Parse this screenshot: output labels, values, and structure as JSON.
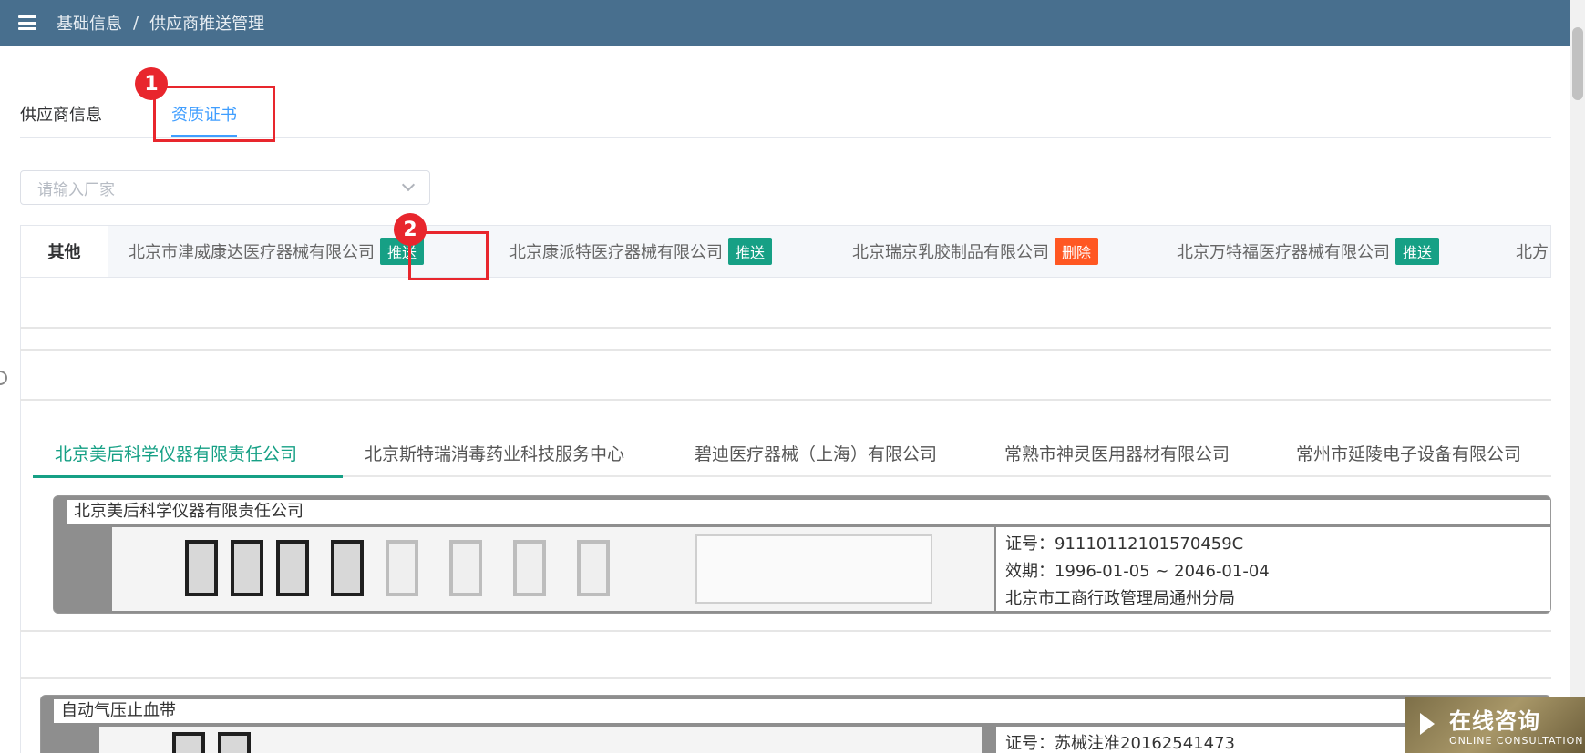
{
  "header": {
    "breadcrumb": [
      "基础信息",
      "供应商推送管理"
    ],
    "separator": "/"
  },
  "top_tabs": [
    {
      "label": "供应商信息",
      "active": false
    },
    {
      "label": "资质证书",
      "active": true
    }
  ],
  "annotations": {
    "marker1": "1",
    "marker2": "2"
  },
  "filter": {
    "placeholder": "请输入厂家"
  },
  "vendor_tabs": [
    {
      "label": "其他",
      "tag": null
    },
    {
      "label": "北京市津威康达医疗器械有限公司",
      "tag": "推送"
    },
    {
      "label": "北京康派特医疗器械有限公司",
      "tag": "推送"
    },
    {
      "label": "北京瑞京乳胶制品有限公司",
      "tag": "删除"
    },
    {
      "label": "北京万特福医疗器械有限公司",
      "tag": "推送"
    },
    {
      "label": "北方",
      "tag": null
    }
  ],
  "manufacturer_tabs": [
    {
      "label": "北京美后科学仪器有限责任公司",
      "active": true
    },
    {
      "label": "北京斯特瑞消毒药业科技服务中心",
      "active": false
    },
    {
      "label": "碧迪医疗器械（上海）有限公司",
      "active": false
    },
    {
      "label": "常熟市神灵医用器材有限公司",
      "active": false
    },
    {
      "label": "常州市延陵电子设备有限公司",
      "active": false
    }
  ],
  "cards": [
    {
      "title": "北京美后科学仪器有限责任公司",
      "cert_no": "证号：91110112101570459C",
      "validity": "效期：1996-01-05 ~ 2046-01-04",
      "issuer": "北京市工商行政管理局通州分局"
    },
    {
      "title": "自动气压止血带",
      "cert_no": "证号：苏械注准20162541473"
    }
  ],
  "consult": {
    "cn": "在线咨询",
    "en": "ONLINE CONSULTATION"
  },
  "colors": {
    "header": "#486f8e",
    "accent_blue": "#409eff",
    "accent_green": "#16a085",
    "delete_orange": "#ff5722",
    "annotation_red": "#e8262d"
  }
}
